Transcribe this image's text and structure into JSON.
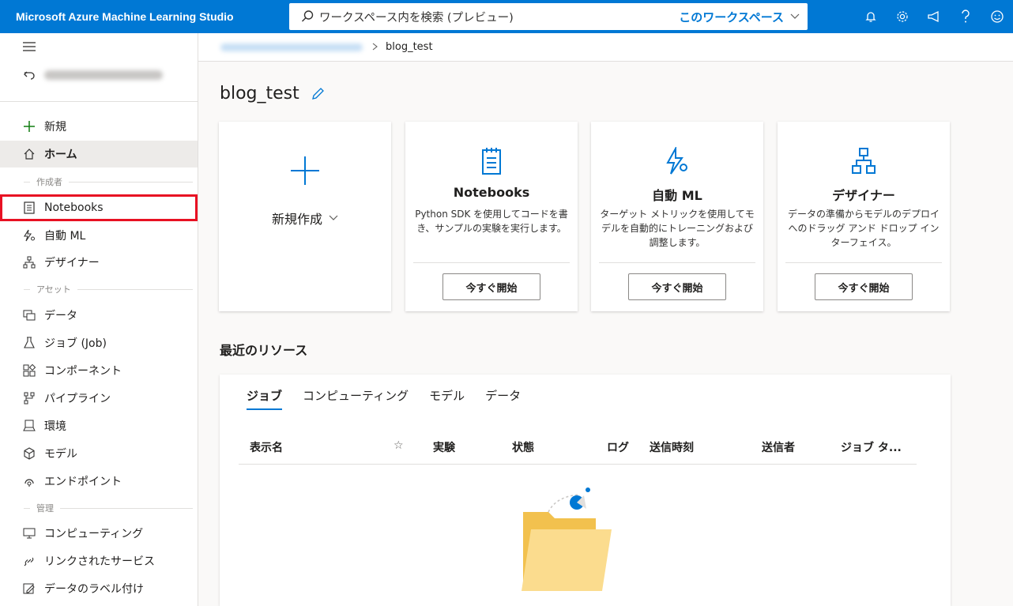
{
  "app": {
    "title": "Microsoft Azure Machine Learning Studio"
  },
  "search": {
    "placeholder": "ワークスペース内を検索 (プレビュー)",
    "scope": "このワークスペース"
  },
  "top_icons": [
    "bell-icon",
    "gear-icon",
    "megaphone-icon",
    "help-icon",
    "smiley-icon"
  ],
  "sidebar": {
    "new_label": "新規",
    "home_label": "ホーム",
    "section_author": "作成者",
    "author_items": [
      {
        "label": "Notebooks",
        "icon": "notebook-icon"
      },
      {
        "label": "自動 ML",
        "icon": "automl-icon"
      },
      {
        "label": "デザイナー",
        "icon": "designer-icon"
      }
    ],
    "section_assets": "アセット",
    "asset_items": [
      {
        "label": "データ",
        "icon": "data-icon"
      },
      {
        "label": "ジョブ (Job)",
        "icon": "job-icon"
      },
      {
        "label": "コンポーネント",
        "icon": "component-icon"
      },
      {
        "label": "パイプライン",
        "icon": "pipeline-icon"
      },
      {
        "label": "環境",
        "icon": "environment-icon"
      },
      {
        "label": "モデル",
        "icon": "model-icon"
      },
      {
        "label": "エンドポイント",
        "icon": "endpoint-icon"
      }
    ],
    "section_manage": "管理",
    "manage_items": [
      {
        "label": "コンピューティング",
        "icon": "compute-icon"
      },
      {
        "label": "リンクされたサービス",
        "icon": "linked-service-icon"
      },
      {
        "label": "データのラベル付け",
        "icon": "labeling-icon"
      }
    ]
  },
  "breadcrumb": {
    "current": "blog_test"
  },
  "page": {
    "title": "blog_test"
  },
  "cards": {
    "new": {
      "label": "新規作成"
    },
    "items": [
      {
        "title": "Notebooks",
        "description": "Python SDK を使用してコードを書き、サンプルの実験を実行します。",
        "button": "今すぐ開始"
      },
      {
        "title": "自動 ML",
        "description": "ターゲット メトリックを使用してモデルを自動的にトレーニングおよび調整します。",
        "button": "今すぐ開始"
      },
      {
        "title": "デザイナー",
        "description": "データの準備からモデルのデプロイへのドラッグ アンド ドロップ インターフェイス。",
        "button": "今すぐ開始"
      }
    ]
  },
  "recent": {
    "title": "最近のリソース",
    "tabs": [
      "ジョブ",
      "コンピューティング",
      "モデル",
      "データ"
    ],
    "columns": [
      "表示名",
      "☆",
      "実験",
      "状態",
      "ログ",
      "送信時刻",
      "送信者",
      "ジョブ タ..."
    ]
  }
}
